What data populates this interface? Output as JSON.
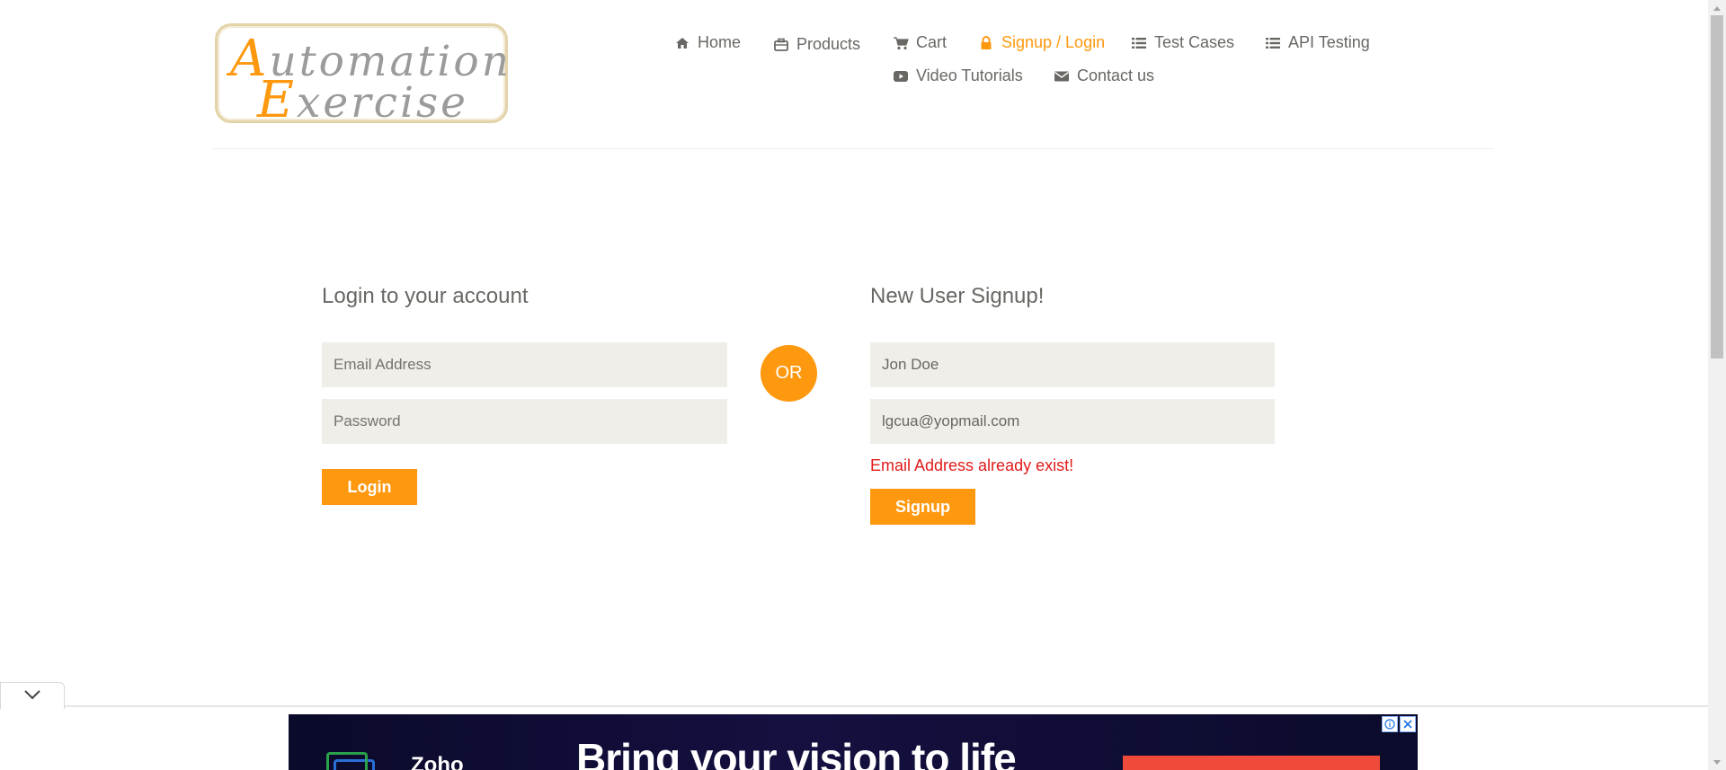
{
  "logo": {
    "line1_cap": "A",
    "line1_rest": "utomation",
    "line2_cap": "E",
    "line2_rest": "xercise"
  },
  "nav": {
    "items": [
      {
        "label": "Home",
        "icon": "home-icon",
        "active": false
      },
      {
        "label": "Products",
        "icon": "products-icon",
        "active": false
      },
      {
        "label": "Cart",
        "icon": "cart-icon",
        "active": false
      },
      {
        "label": "Signup / Login",
        "icon": "lock-icon",
        "active": true
      },
      {
        "label": "Test Cases",
        "icon": "list-icon",
        "active": false
      },
      {
        "label": "API Testing",
        "icon": "list-icon",
        "active": false
      },
      {
        "label": "Video Tutorials",
        "icon": "youtube-icon",
        "active": false
      },
      {
        "label": "Contact us",
        "icon": "envelope-icon",
        "active": false
      }
    ]
  },
  "login": {
    "title": "Login to your account",
    "email_placeholder": "Email Address",
    "password_placeholder": "Password",
    "button": "Login"
  },
  "or_label": "OR",
  "signup": {
    "title": "New User Signup!",
    "name_value": "Jon Doe",
    "email_value": "lgcua@yopmail.com",
    "error": "Email Address already exist!",
    "button": "Signup"
  },
  "ad": {
    "brand": "Zoho",
    "headline": "Bring your vision to life"
  },
  "colors": {
    "accent": "#fe980f",
    "error": "#e01a1a",
    "field_bg": "#efeee8",
    "text": "#696763"
  }
}
